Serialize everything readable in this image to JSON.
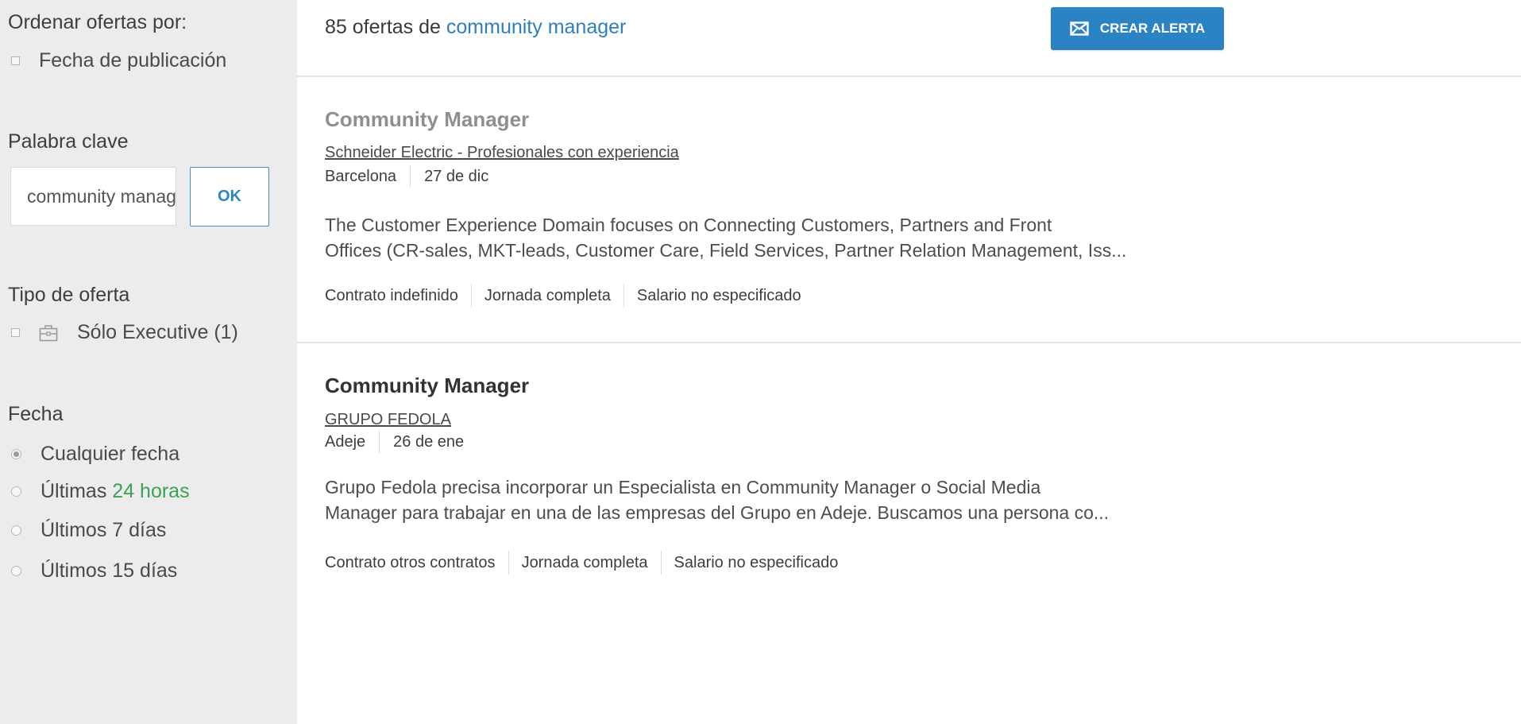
{
  "sidebar": {
    "sort": {
      "heading": "Ordenar ofertas por:",
      "option_date": "Fecha de publicación"
    },
    "keyword": {
      "heading": "Palabra clave",
      "value": "community manager",
      "ok_label": "OK"
    },
    "offer_type": {
      "heading": "Tipo de oferta",
      "executive_label": "Sólo Executive (1)",
      "icon": "briefcase-icon"
    },
    "date": {
      "heading": "Fecha",
      "options": [
        {
          "label": "Cualquier fecha",
          "selected": true
        },
        {
          "prefix": "Últimas ",
          "highlight": "24 horas",
          "selected": false
        },
        {
          "label": "Últimos 7 días",
          "selected": false
        },
        {
          "label": "Últimos 15 días",
          "selected": false
        }
      ]
    }
  },
  "header": {
    "results_prefix": "85 ofertas de ",
    "query": "community manager",
    "alert_button": "CREAR ALERTA",
    "alert_icon": "envelope-icon",
    "alert_color": "#2c83c3"
  },
  "offers": [
    {
      "title": "Community Manager",
      "company": "Schneider Electric - Profesionales con experiencia",
      "location": "Barcelona",
      "date": "27 de dic",
      "description_line1": "The Customer Experience Domain focuses on Connecting Customers, Partners and Front",
      "description_line2": "Offices (CR-sales, MKT-leads, Customer Care, Field Services, Partner Relation Management, Iss...",
      "tags": [
        "Contrato indefinido",
        "Jornada completa",
        "Salario no especificado"
      ]
    },
    {
      "title": "Community Manager",
      "company": "GRUPO FEDOLA",
      "location": "Adeje",
      "date": "26 de ene",
      "description_line1": "Grupo Fedola precisa incorporar un Especialista en Community Manager o Social Media",
      "description_line2": "Manager para trabajar en una de las empresas del Grupo en Adeje. Buscamos una persona co...",
      "tags": [
        "Contrato otros contratos",
        "Jornada completa",
        "Salario no especificado"
      ]
    }
  ]
}
